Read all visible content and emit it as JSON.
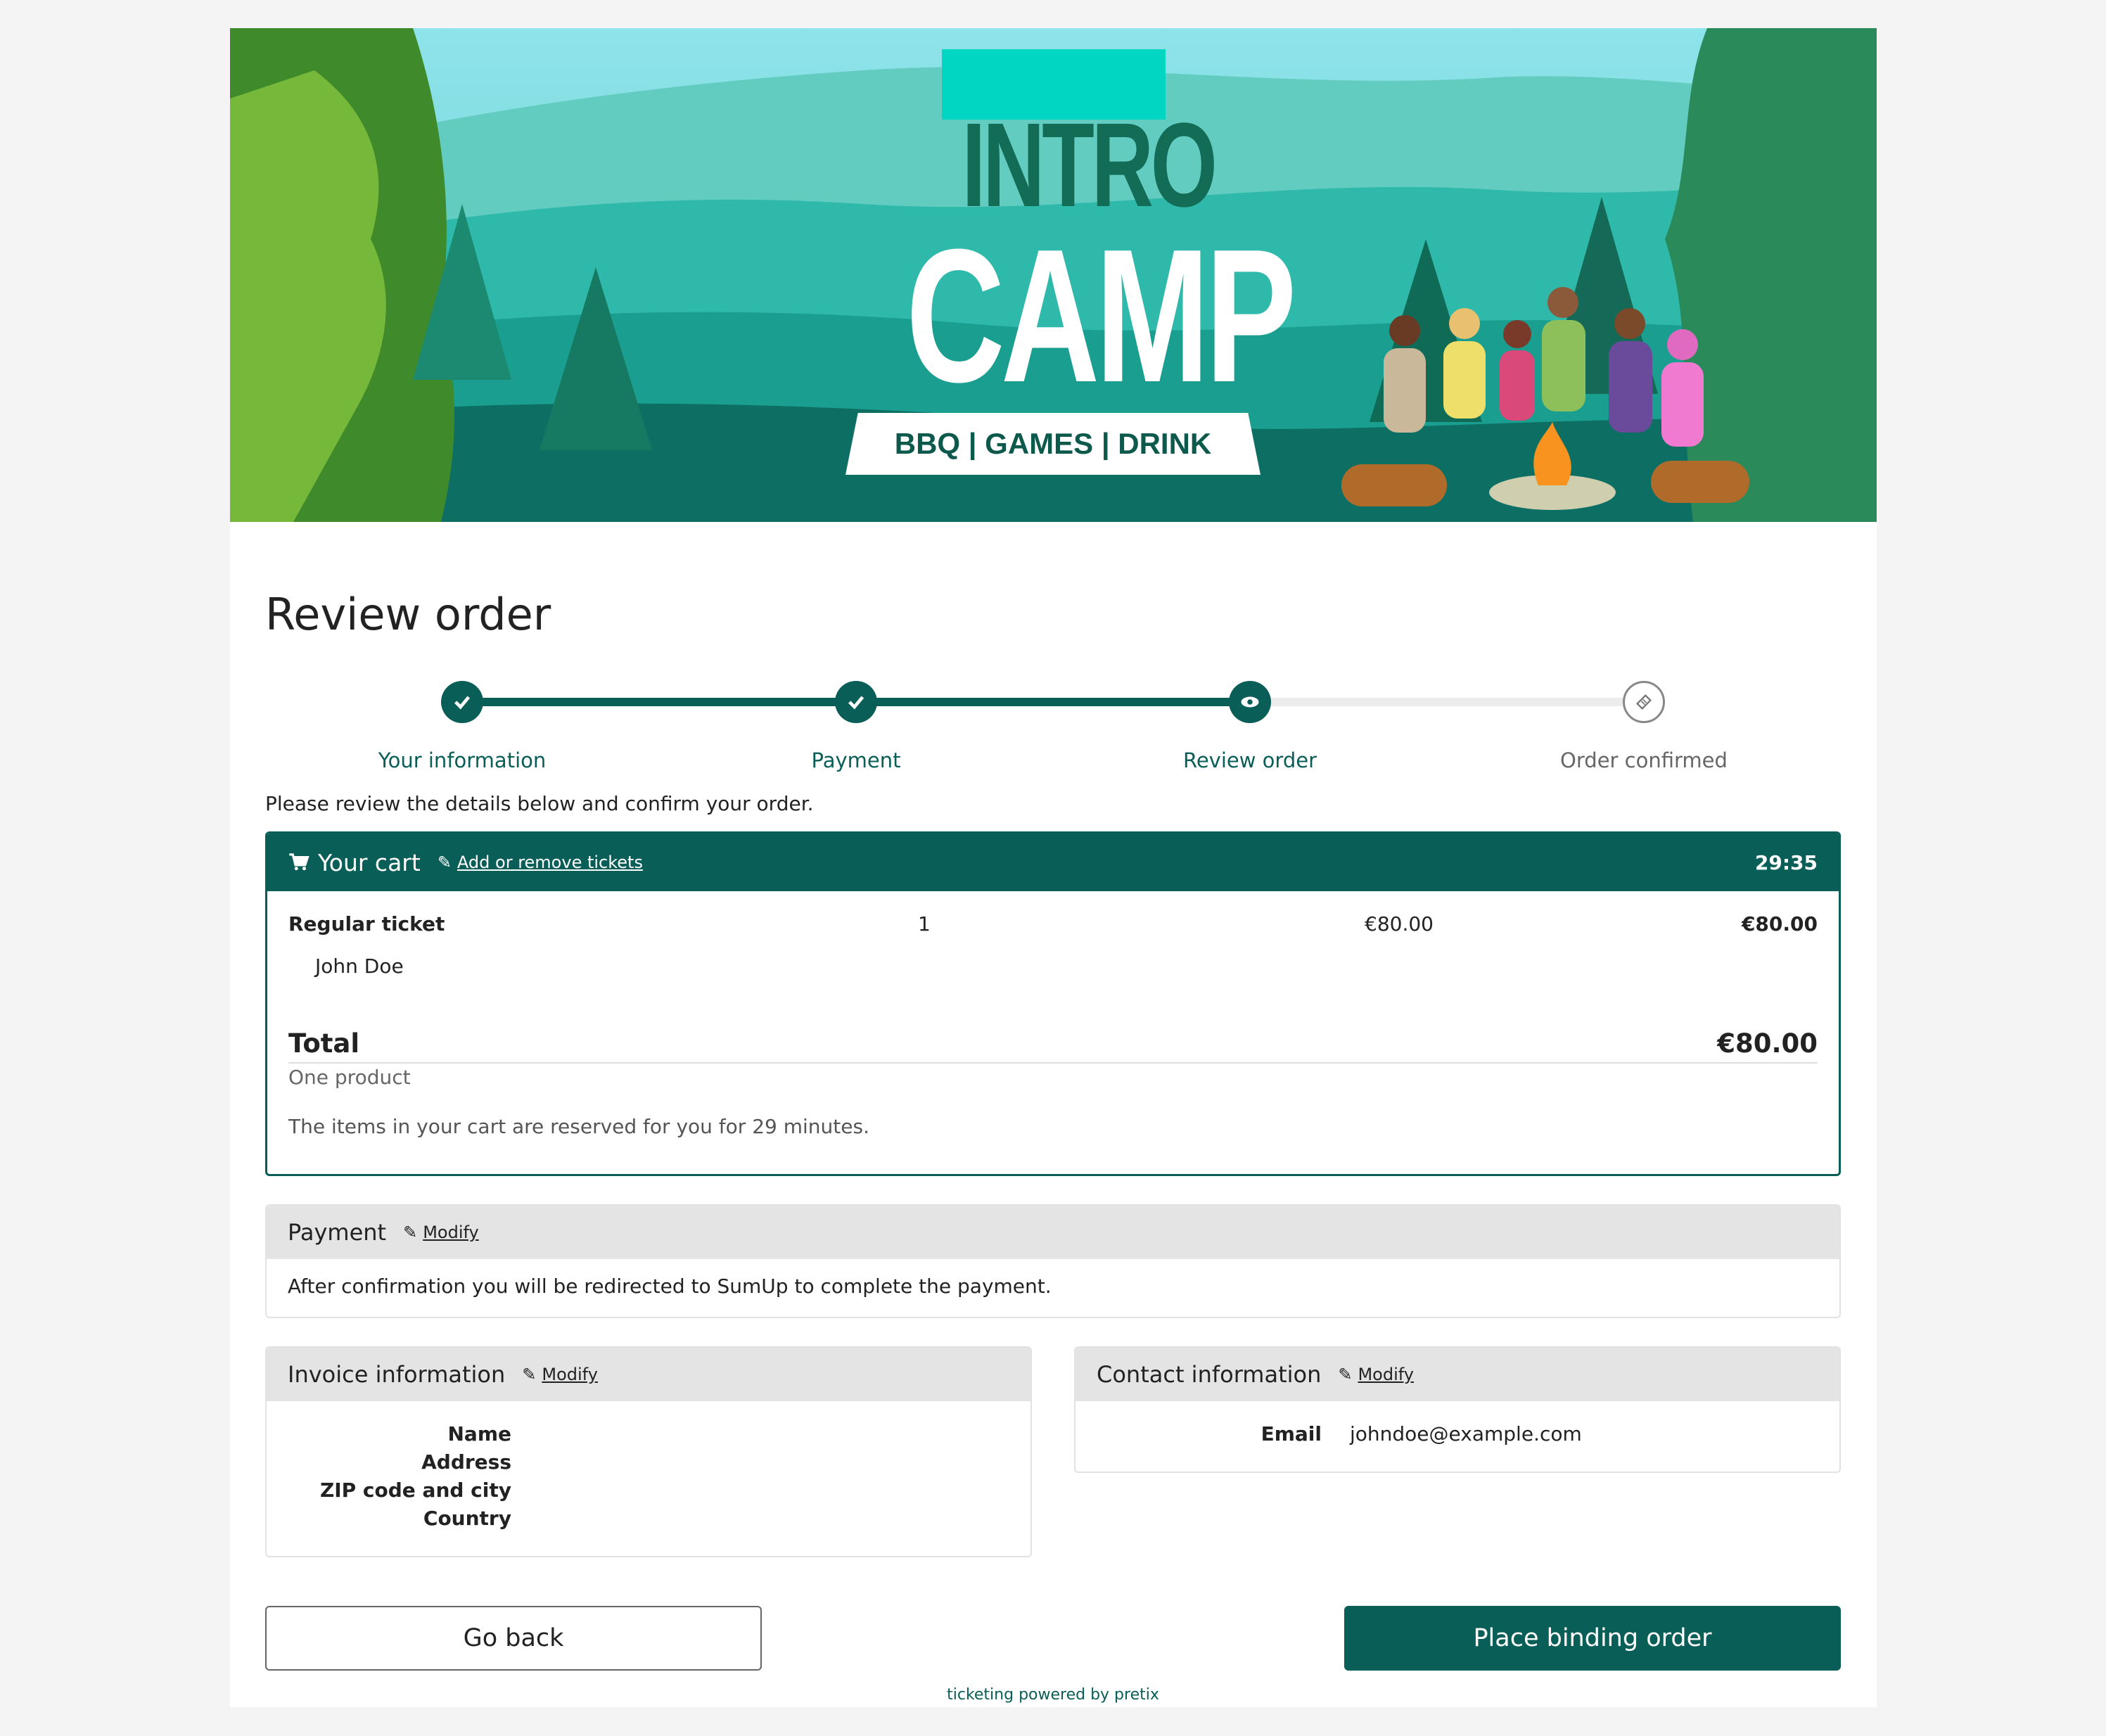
{
  "banner": {
    "line1": "INTRO",
    "line2": "CAMP",
    "ribbon": "BBQ | GAMES | DRINK"
  },
  "page_title": "Review order",
  "steps": [
    {
      "label": "Your information",
      "state": "done",
      "icon": "check-icon"
    },
    {
      "label": "Payment",
      "state": "done",
      "icon": "check-icon"
    },
    {
      "label": "Review order",
      "state": "current",
      "icon": "eye-icon"
    },
    {
      "label": "Order confirmed",
      "state": "todo",
      "icon": "ticket-icon"
    }
  ],
  "intro_text": "Please review the details below and confirm your order.",
  "cart": {
    "title": "Your cart",
    "modify_link": "Add or remove tickets",
    "timer": "29:35",
    "item": {
      "name": "Regular ticket",
      "attendee": "John Doe",
      "quantity": "1",
      "unit_price": "€80.00",
      "total": "€80.00"
    },
    "total_label": "Total",
    "total_value": "€80.00",
    "product_count": "One product",
    "reservation_note": "The items in your cart are reserved for you for 29 minutes."
  },
  "payment": {
    "title": "Payment",
    "modify_link": "Modify",
    "text": "After confirmation you will be redirected to SumUp to complete the payment."
  },
  "invoice": {
    "title": "Invoice information",
    "modify_link": "Modify",
    "fields": [
      "Name",
      "Address",
      "ZIP code and city",
      "Country"
    ]
  },
  "contact": {
    "title": "Contact information",
    "modify_link": "Modify",
    "email_label": "Email",
    "email_value": "johndoe@example.com"
  },
  "buttons": {
    "back": "Go back",
    "place": "Place binding order"
  },
  "footer": "ticketing powered by pretix",
  "colors": {
    "primary": "#0a5e58",
    "background": "#f4f4f4",
    "panel_header": "#e4e4e4"
  }
}
